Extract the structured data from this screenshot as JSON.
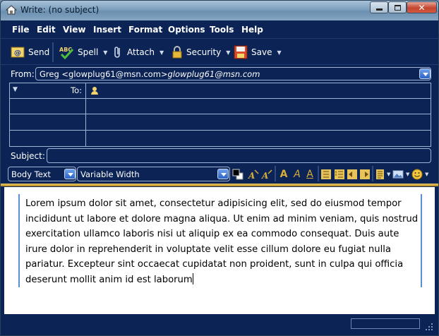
{
  "window": {
    "title": "Write: (no subject)",
    "controls": [
      "minimize",
      "maximize",
      "close"
    ]
  },
  "menu": [
    {
      "label": "File"
    },
    {
      "label": "Edit"
    },
    {
      "label": "View"
    },
    {
      "label": "Insert"
    },
    {
      "label": "Format"
    },
    {
      "label": "Options"
    },
    {
      "label": "Tools"
    },
    {
      "label": "Help"
    }
  ],
  "toolbar": {
    "send": "Send",
    "spell": "Spell",
    "attach": "Attach",
    "security": "Security",
    "save": "Save"
  },
  "address": {
    "from_label": "From:",
    "from_value_plain": "Greg <glowplug61@msn.com>",
    "from_value_italic": "glowplug61@msn.com",
    "to_label": "To:",
    "to_value": "",
    "subject_label": "Subject:",
    "subject_value": ""
  },
  "format": {
    "paragraph_style": "Body Text",
    "font": "Variable Width"
  },
  "body": {
    "text": "Lorem ipsum dolor sit amet, consectetur adipisicing elit, sed do eiusmod tempor incididunt ut labore et dolore magna aliqua. Ut enim ad minim veniam, quis nostrud exercitation ullamco laboris nisi ut aliquip ex ea commodo consequat. Duis aute irure dolor in reprehenderit in voluptate velit esse cillum dolore eu fugiat nulla pariatur. Excepteur sint occaecat cupidatat non proident, sunt in culpa qui officia deserunt mollit anim id est laborum"
  },
  "colors": {
    "chrome": "#0b2455",
    "border": "#9fb3d3",
    "accent_gold": "#d7ad3a",
    "quote_bar": "#5b8fcf"
  }
}
